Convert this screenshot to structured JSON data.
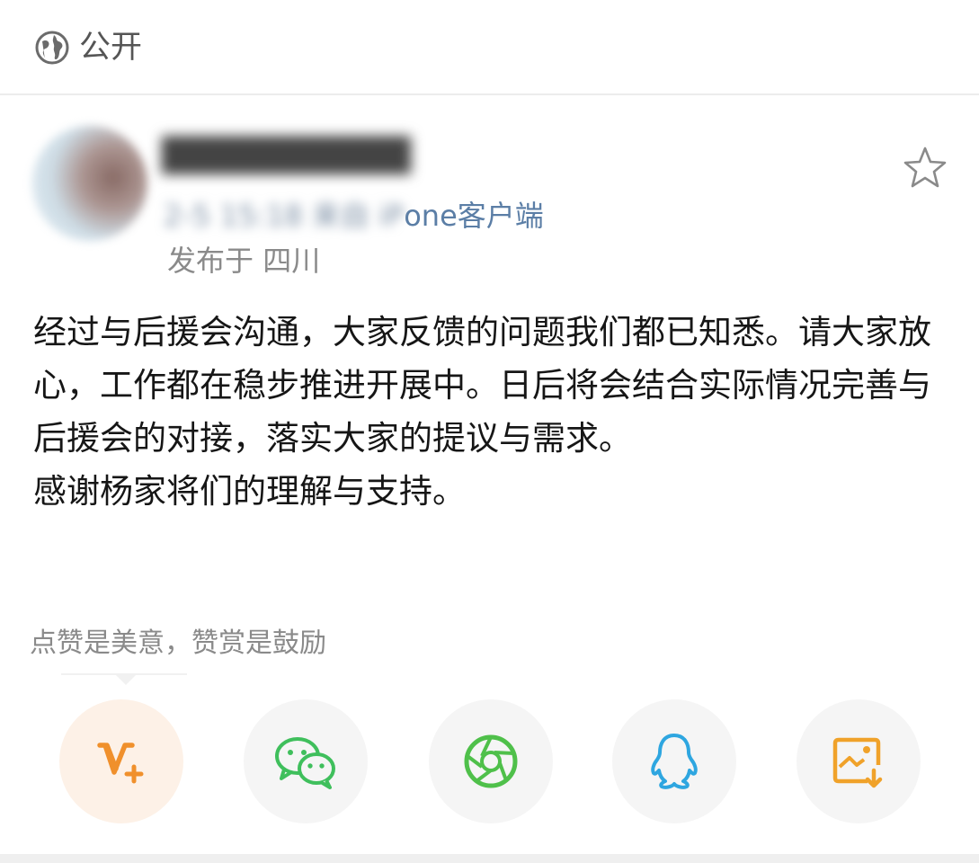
{
  "header": {
    "visibility_label": "公开",
    "visibility_icon": "globe-icon"
  },
  "post": {
    "author_name": "",
    "meta": {
      "time_blurred": "2-5 15:18 来自 iP",
      "source_visible": "one客户端"
    },
    "location": {
      "prefix": "发布于",
      "place": "四川"
    },
    "favorite_icon": "star-outline-icon",
    "body_lines": [
      "经过与后援会沟通，大家反馈的问题我们都已知悉。请大家放心，工作都在稳步推进开展中。日后将会结合实际情况完善与后援会的对接，落实大家的提议与需求。",
      "感谢杨家将们的理解与支持。"
    ]
  },
  "reward": {
    "hint": "点赞是美意，赞赏是鼓励"
  },
  "share": {
    "buttons": [
      {
        "icon": "v-plus-icon",
        "color": "#f0902c"
      },
      {
        "icon": "wechat-icon",
        "color": "#3fbf5c"
      },
      {
        "icon": "moments-shutter-icon",
        "color": "#4fc04a"
      },
      {
        "icon": "qq-penguin-icon",
        "color": "#2ea6e0"
      },
      {
        "icon": "save-image-icon",
        "color": "#f0a22a"
      }
    ]
  },
  "colors": {
    "link_blue": "#5b7ea6",
    "muted_gray": "#8a8a8a",
    "accent_orange": "#f0902c"
  }
}
